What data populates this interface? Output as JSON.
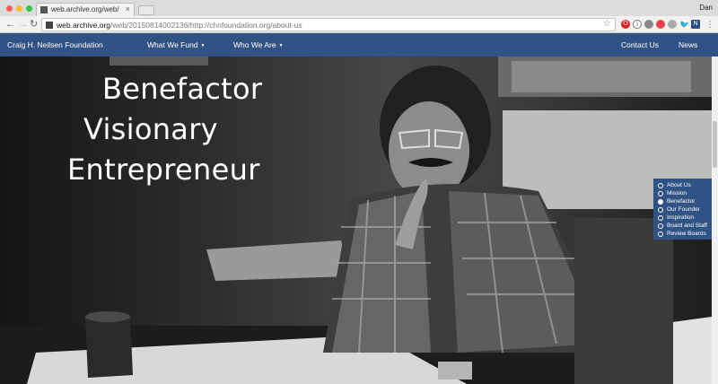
{
  "browser": {
    "tab_title": "web.archive.org/web/20150814002136",
    "tab_close": "×",
    "user_name": "Dan",
    "url_host": "web.archive.org",
    "url_path": "/web/20150814002136/http://chnfoundation.org/about-us",
    "icons": [
      "back-icon",
      "forward-icon",
      "reload-icon",
      "star-icon",
      "opera-icon",
      "info-icon",
      "shield-icon",
      "pocket-icon",
      "search-icon",
      "twitter-icon",
      "n-icon",
      "menu-icon"
    ]
  },
  "site_nav": {
    "brand": "Craig H. Neilsen Foundation",
    "what_we_fund": "What We Fund",
    "who_we_are": "Who We Are",
    "contact_us": "Contact Us",
    "news": "News"
  },
  "hero": {
    "line1": "Benefactor",
    "line2": "Visionary",
    "line3": "Entrepreneur"
  },
  "section_nav": {
    "items": [
      {
        "label": "About Us",
        "active": false
      },
      {
        "label": "Mission",
        "active": false
      },
      {
        "label": "Benefactor",
        "active": true
      },
      {
        "label": "Our Founder",
        "active": false
      },
      {
        "label": "Inspiration",
        "active": false
      },
      {
        "label": "Board and Staff",
        "active": false
      },
      {
        "label": "Review Boards",
        "active": false
      }
    ]
  },
  "colors": {
    "nav_blue": "#2f5384",
    "hero_text": "#ffffff"
  }
}
